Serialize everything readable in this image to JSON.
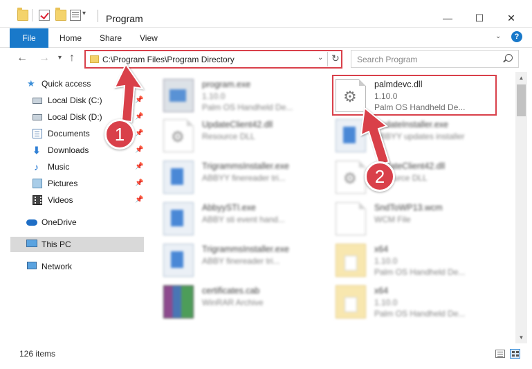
{
  "window": {
    "title": "Program",
    "minimize": "—",
    "maximize": "☐",
    "close": "✕"
  },
  "ribbon": {
    "file": "File",
    "home": "Home",
    "share": "Share",
    "view": "View"
  },
  "nav": {
    "back": "←",
    "forward": "→",
    "recent": "▾",
    "up": "↑",
    "address": "C:\\Program Files\\Program Directory",
    "search_placeholder": "Search Program"
  },
  "sidebar": {
    "items": [
      {
        "label": "Quick access"
      },
      {
        "label": "Local Disk (C:)"
      },
      {
        "label": "Local Disk (D:)"
      },
      {
        "label": "Documents"
      },
      {
        "label": "Downloads"
      },
      {
        "label": "Music"
      },
      {
        "label": "Pictures"
      },
      {
        "label": "Videos"
      },
      {
        "label": "OneDrive"
      },
      {
        "label": "This PC"
      },
      {
        "label": "Network"
      }
    ]
  },
  "files": [
    {
      "name": "program.exe",
      "sub1": "1.10.0",
      "sub2": "Palm OS Handheld De..."
    },
    {
      "name": "palmdevc.dll",
      "sub1": "1.10.0",
      "sub2": "Palm OS Handheld De..."
    },
    {
      "name": "UpdateClient42.dll",
      "sub1": "Resource DLL",
      "sub2": ""
    },
    {
      "name": "UpdateInstaller.exe",
      "sub1": "ABBYY updates installer",
      "sub2": ""
    },
    {
      "name": "TrigrammsInstaller.exe",
      "sub1": "ABBYY finereader tri...",
      "sub2": ""
    },
    {
      "name": "UpdateClient42.dll",
      "sub1": "Resource DLL",
      "sub2": ""
    },
    {
      "name": "AbbyySTI.exe",
      "sub1": "ABBY sti event hand...",
      "sub2": ""
    },
    {
      "name": "SndToWP13.wcm",
      "sub1": "WCM File",
      "sub2": ""
    },
    {
      "name": "TrigrammsInstaller.exe",
      "sub1": "ABBY finereader tri...",
      "sub2": ""
    },
    {
      "name": "x64",
      "sub1": "1.10.0",
      "sub2": "Palm OS Handheld De..."
    },
    {
      "name": "certificates.cab",
      "sub1": "WinRAR Archive",
      "sub2": ""
    },
    {
      "name": "x64",
      "sub1": "1.10.0",
      "sub2": "Palm OS Handheld De..."
    }
  ],
  "status": {
    "count": "126 items"
  },
  "annotations": {
    "step1": "1",
    "step2": "2",
    "color": "#d9404a"
  }
}
